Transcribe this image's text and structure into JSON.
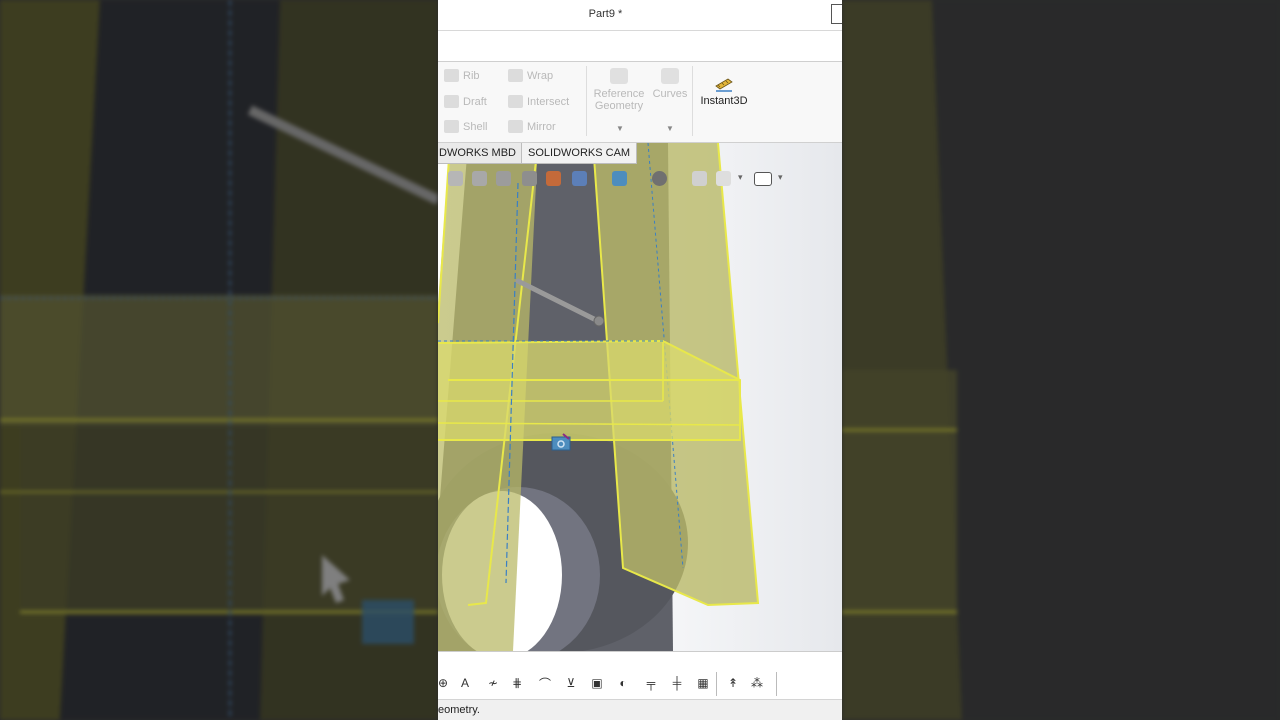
{
  "window": {
    "title": "Part9 *"
  },
  "ribbon": {
    "features": [
      {
        "label": "Rib",
        "icon": "rib-icon"
      },
      {
        "label": "Wrap",
        "icon": "wrap-icon"
      },
      {
        "label": "Draft",
        "icon": "draft-icon"
      },
      {
        "label": "Intersect",
        "icon": "intersect-icon"
      },
      {
        "label": "Shell",
        "icon": "shell-icon"
      },
      {
        "label": "Mirror",
        "icon": "mirror-icon"
      }
    ],
    "reference_geometry": {
      "line1": "Reference",
      "line2": "Geometry"
    },
    "curves": "Curves",
    "instant3d": "Instant3D"
  },
  "tabs": [
    {
      "label": "DWORKS MBD"
    },
    {
      "label": "SOLIDWORKS CAM"
    }
  ],
  "statusbar": {
    "text": "eometry."
  },
  "colors": {
    "selection_yellow": "#e8e84a",
    "model_fill": "#b9b968",
    "hole_gray": "#5e6068",
    "accent_blue": "#3a7fc4"
  }
}
